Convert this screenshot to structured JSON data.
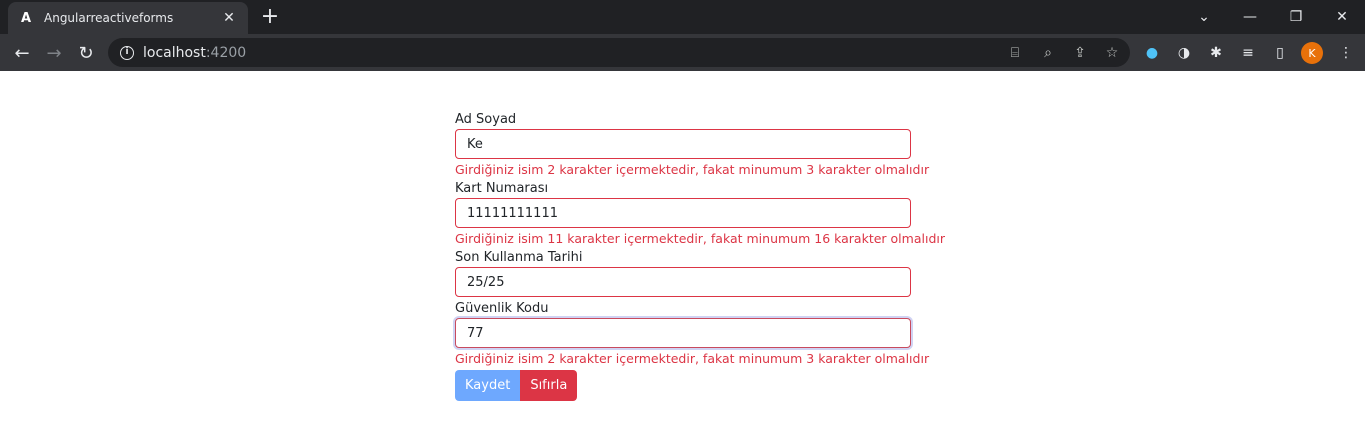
{
  "browser": {
    "tab_title": "Angularreactiveforms",
    "tab_favicon": "A",
    "url_host": "localhost",
    "url_port": ":4200",
    "avatar_letter": "K"
  },
  "form": {
    "name": {
      "label": "Ad Soyad",
      "value": "Ke",
      "error": "Girdiğiniz isim 2 karakter içermektedir, fakat minumum 3 karakter olmalıdır"
    },
    "card": {
      "label": "Kart Numarası",
      "value": "11111111111",
      "error": "Girdiğiniz isim 11 karakter içermektedir, fakat minumum 16 karakter olmalıdır"
    },
    "expiry": {
      "label": "Son Kullanma Tarihi",
      "value": "25/25"
    },
    "cvc": {
      "label": "Güvenlik Kodu",
      "value": "77",
      "error": "Girdiğiniz isim 2 karakter içermektedir, fakat minumum 3 karakter olmalıdır"
    },
    "save_label": "Kaydet",
    "reset_label": "Sıfırla"
  },
  "colors": {
    "error": "#dc3545",
    "primary_button": "#6ea8fe",
    "danger_button": "#dc3545"
  }
}
